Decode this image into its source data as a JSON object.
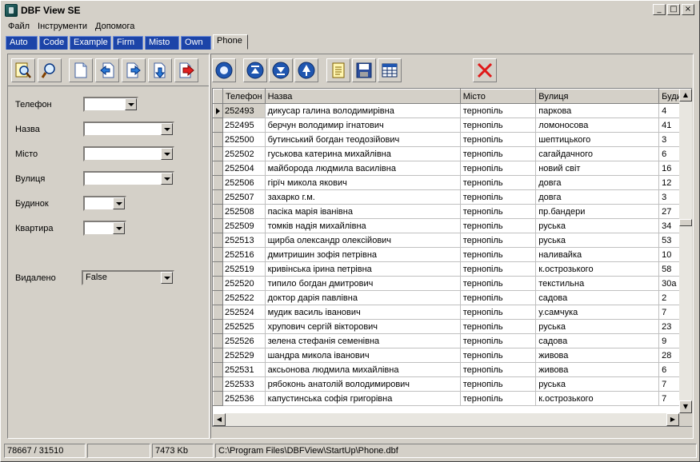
{
  "window": {
    "title": "DBF View SE"
  },
  "menu": [
    "Файл",
    "Інструменти",
    "Допомога"
  ],
  "tabs": [
    {
      "label": "Auto"
    },
    {
      "label": "Code"
    },
    {
      "label": "Example"
    },
    {
      "label": "Firm"
    },
    {
      "label": "Misto"
    },
    {
      "label": "Own"
    },
    {
      "label": "Phone",
      "active": true
    }
  ],
  "left_toolbar_icons": [
    "find-preview-icon",
    "search-icon",
    "blank-page-icon",
    "page-back-icon",
    "page-forward-icon",
    "page-down-icon",
    "page-arrow-red-icon"
  ],
  "right_toolbar_icons": [
    "circle-icon",
    "first-record-icon",
    "last-record-icon",
    "up-record-icon",
    "notepad-icon",
    "save-icon",
    "table-icon",
    "delete-icon"
  ],
  "form": {
    "fields": [
      {
        "label": "Телефон",
        "value": ""
      },
      {
        "label": "Назва",
        "value": ""
      },
      {
        "label": "Місто",
        "value": ""
      },
      {
        "label": "Вулиця",
        "value": ""
      },
      {
        "label": "Будинок",
        "value": ""
      },
      {
        "label": "Квартира",
        "value": ""
      }
    ],
    "deleted": {
      "label": "Видалено",
      "value": "False"
    }
  },
  "grid": {
    "columns": [
      "Телефон",
      "Назва",
      "Місто",
      "Вулиця",
      "Буди"
    ],
    "rows": [
      [
        "252493",
        "дикусар галина володимирівна",
        "тернопіль",
        "паркова",
        "4"
      ],
      [
        "252495",
        "берчун володимир ігнатович",
        "тернопіль",
        "ломоносова",
        "41"
      ],
      [
        "252500",
        "бутинський богдан теодозійович",
        "тернопіль",
        "шептицького",
        "3"
      ],
      [
        "252502",
        "гуськова катерина михайлівна",
        "тернопіль",
        "сагайдачного",
        "6"
      ],
      [
        "252504",
        "майборода людмила василівна",
        "тернопіль",
        "новий світ",
        "16"
      ],
      [
        "252506",
        "гірїч микола якович",
        "тернопіль",
        "довга",
        "12"
      ],
      [
        "252507",
        "захарко г.м.",
        "тернопіль",
        "довга",
        "3"
      ],
      [
        "252508",
        "пасіка марія іванівна",
        "тернопіль",
        "пр.бандери",
        "27"
      ],
      [
        "252509",
        "томків надія михайлівна",
        "тернопіль",
        "руська",
        "34"
      ],
      [
        "252513",
        "щирба олександр олексійович",
        "тернопіль",
        "руська",
        "53"
      ],
      [
        "252516",
        "дмитришин зофія петрівна",
        "тернопіль",
        "наливайка",
        "10"
      ],
      [
        "252519",
        "кривінська ірина петрівна",
        "тернопіль",
        "к.острозького",
        "58"
      ],
      [
        "252520",
        "типило богдан дмитрович",
        "тернопіль",
        "текстильна",
        "30а"
      ],
      [
        "252522",
        "доктор дарія павлівна",
        "тернопіль",
        "садова",
        "2"
      ],
      [
        "252524",
        "мудик василь іванович",
        "тернопіль",
        "у.самчука",
        "7"
      ],
      [
        "252525",
        "хрупович сергій вікторович",
        "тернопіль",
        "руська",
        "23"
      ],
      [
        "252526",
        "зелена стефанія семенівна",
        "тернопіль",
        "садова",
        "9"
      ],
      [
        "252529",
        "шандра микола іванович",
        "тернопіль",
        "живова",
        "28"
      ],
      [
        "252531",
        "аксьонова людмила михайлівна",
        "тернопіль",
        "живова",
        "6"
      ],
      [
        "252533",
        "рябоконь анатолій володимирович",
        "тернопіль",
        "руська",
        "7"
      ],
      [
        "252536",
        "капустинська софія григорівна",
        "тернопіль",
        "к.острозького",
        "7"
      ]
    ],
    "selected_row": 0
  },
  "status": {
    "records": "78667 / 31510",
    "empty": "",
    "size": "7473 Kb",
    "path": "C:\\Program Files\\DBFView\\StartUp\\Phone.dbf"
  }
}
